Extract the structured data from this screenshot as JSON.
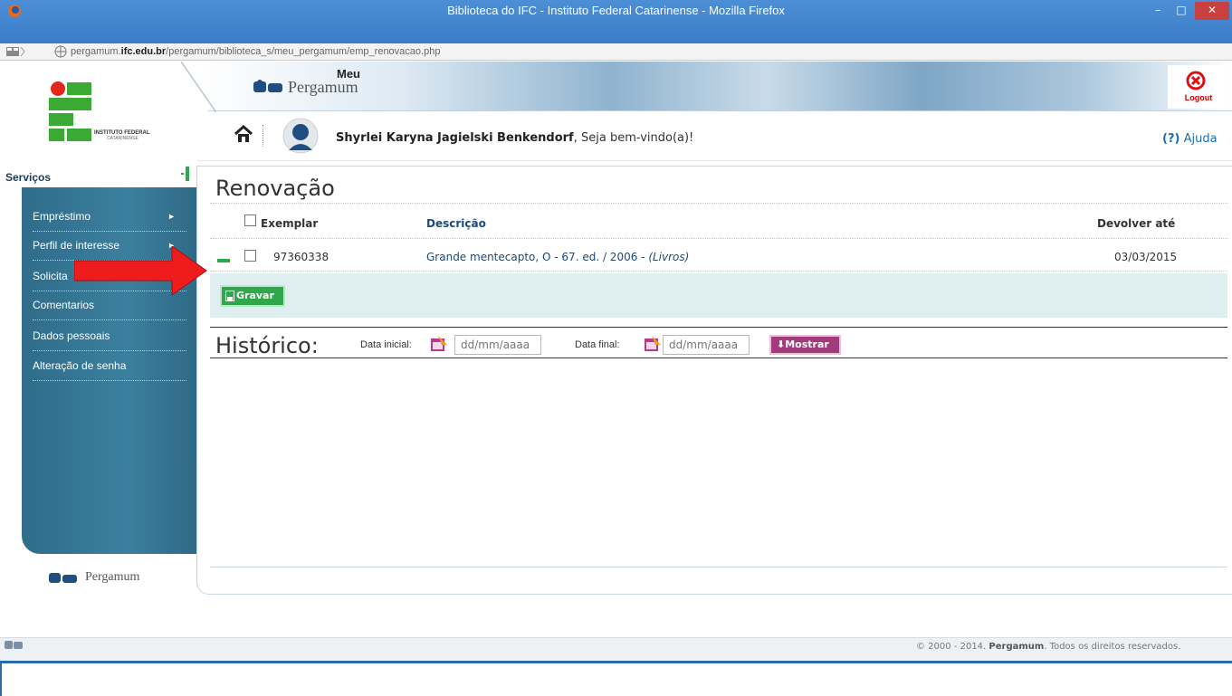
{
  "window": {
    "title": "Biblioteca do IFC - Instituto Federal Catarinense - Mozilla Firefox",
    "minimize_label": "–",
    "maximize_label": "□",
    "close_label": "✕"
  },
  "address": {
    "url_prefix": "pergamum.",
    "url_domain": "ifc.edu.br",
    "url_path": "/pergamum/biblioteca_s/meu_pergamum/emp_renovacao.php"
  },
  "header": {
    "brand_meu": "Meu",
    "brand_pergamum": "Pergamum",
    "logout_label": "Logout",
    "logo_text_line1": "INSTITUTO FEDERAL",
    "logo_text_line2": "CATARINENSE"
  },
  "userbar": {
    "user_name": "Shyrlei Karyna Jagielski Benkendorf",
    "welcome_suffix": ", Seja bem-vindo(a)!",
    "help_prefix": "(?)",
    "help_label": " Ajuda"
  },
  "sidebar": {
    "title": "Serviços",
    "items": [
      {
        "label": "Empréstimo",
        "has_arrow": true
      },
      {
        "label": "Perfil de interesse",
        "has_arrow": true
      },
      {
        "label": "Solicita"
      },
      {
        "label": "Comentarios"
      },
      {
        "label": "Dados pessoais"
      },
      {
        "label": "Alteração de senha"
      }
    ],
    "arrow_glyph": "►",
    "footer_brand": "Pergamum"
  },
  "main": {
    "title": "Renovação",
    "table": {
      "headers": {
        "exemplar": "Exemplar",
        "descricao": "Descrição",
        "devolver": "Devolver até"
      },
      "rows": [
        {
          "exemplar": "97360338",
          "descricao": "Grande mentecapto, O - 67. ed. / 2006 - ",
          "tipo": "(Livros)",
          "devolver": "03/03/2015"
        }
      ]
    },
    "gravar_label": "Gravar",
    "historico": {
      "title": "Histórico:",
      "data_inicial_label": "Data inicial:",
      "data_final_label": "Data final:",
      "placeholder": "dd/mm/aaaa",
      "mostrar_label": "Mostrar"
    }
  },
  "footer": {
    "copyright_prefix": "© 2000 - 2014. ",
    "copyright_brand": "Pergamum",
    "copyright_suffix": ". Todos os direitos reservados."
  },
  "colors": {
    "titlebar": "#3a7dc8",
    "sidebar": "#3b7f9e",
    "gravar": "#2ea84a",
    "mostrar": "#a23a7c",
    "annotation_arrow": "#ee1c1c"
  }
}
